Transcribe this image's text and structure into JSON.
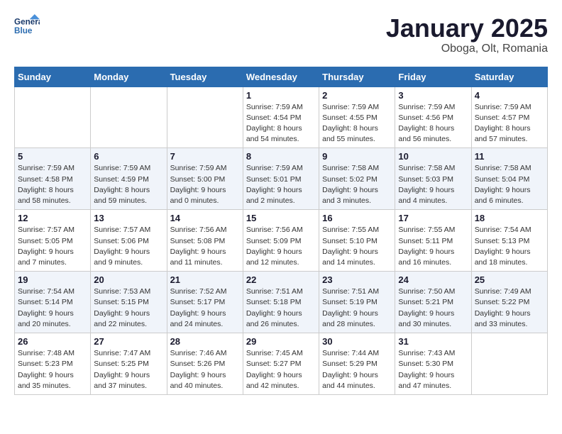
{
  "logo": {
    "line1": "General",
    "line2": "Blue"
  },
  "title": "January 2025",
  "subtitle": "Oboga, Olt, Romania",
  "weekdays": [
    "Sunday",
    "Monday",
    "Tuesday",
    "Wednesday",
    "Thursday",
    "Friday",
    "Saturday"
  ],
  "weeks": [
    [
      {
        "day": "",
        "info": ""
      },
      {
        "day": "",
        "info": ""
      },
      {
        "day": "",
        "info": ""
      },
      {
        "day": "1",
        "info": "Sunrise: 7:59 AM\nSunset: 4:54 PM\nDaylight: 8 hours\nand 54 minutes."
      },
      {
        "day": "2",
        "info": "Sunrise: 7:59 AM\nSunset: 4:55 PM\nDaylight: 8 hours\nand 55 minutes."
      },
      {
        "day": "3",
        "info": "Sunrise: 7:59 AM\nSunset: 4:56 PM\nDaylight: 8 hours\nand 56 minutes."
      },
      {
        "day": "4",
        "info": "Sunrise: 7:59 AM\nSunset: 4:57 PM\nDaylight: 8 hours\nand 57 minutes."
      }
    ],
    [
      {
        "day": "5",
        "info": "Sunrise: 7:59 AM\nSunset: 4:58 PM\nDaylight: 8 hours\nand 58 minutes."
      },
      {
        "day": "6",
        "info": "Sunrise: 7:59 AM\nSunset: 4:59 PM\nDaylight: 8 hours\nand 59 minutes."
      },
      {
        "day": "7",
        "info": "Sunrise: 7:59 AM\nSunset: 5:00 PM\nDaylight: 9 hours\nand 0 minutes."
      },
      {
        "day": "8",
        "info": "Sunrise: 7:59 AM\nSunset: 5:01 PM\nDaylight: 9 hours\nand 2 minutes."
      },
      {
        "day": "9",
        "info": "Sunrise: 7:58 AM\nSunset: 5:02 PM\nDaylight: 9 hours\nand 3 minutes."
      },
      {
        "day": "10",
        "info": "Sunrise: 7:58 AM\nSunset: 5:03 PM\nDaylight: 9 hours\nand 4 minutes."
      },
      {
        "day": "11",
        "info": "Sunrise: 7:58 AM\nSunset: 5:04 PM\nDaylight: 9 hours\nand 6 minutes."
      }
    ],
    [
      {
        "day": "12",
        "info": "Sunrise: 7:57 AM\nSunset: 5:05 PM\nDaylight: 9 hours\nand 7 minutes."
      },
      {
        "day": "13",
        "info": "Sunrise: 7:57 AM\nSunset: 5:06 PM\nDaylight: 9 hours\nand 9 minutes."
      },
      {
        "day": "14",
        "info": "Sunrise: 7:56 AM\nSunset: 5:08 PM\nDaylight: 9 hours\nand 11 minutes."
      },
      {
        "day": "15",
        "info": "Sunrise: 7:56 AM\nSunset: 5:09 PM\nDaylight: 9 hours\nand 12 minutes."
      },
      {
        "day": "16",
        "info": "Sunrise: 7:55 AM\nSunset: 5:10 PM\nDaylight: 9 hours\nand 14 minutes."
      },
      {
        "day": "17",
        "info": "Sunrise: 7:55 AM\nSunset: 5:11 PM\nDaylight: 9 hours\nand 16 minutes."
      },
      {
        "day": "18",
        "info": "Sunrise: 7:54 AM\nSunset: 5:13 PM\nDaylight: 9 hours\nand 18 minutes."
      }
    ],
    [
      {
        "day": "19",
        "info": "Sunrise: 7:54 AM\nSunset: 5:14 PM\nDaylight: 9 hours\nand 20 minutes."
      },
      {
        "day": "20",
        "info": "Sunrise: 7:53 AM\nSunset: 5:15 PM\nDaylight: 9 hours\nand 22 minutes."
      },
      {
        "day": "21",
        "info": "Sunrise: 7:52 AM\nSunset: 5:17 PM\nDaylight: 9 hours\nand 24 minutes."
      },
      {
        "day": "22",
        "info": "Sunrise: 7:51 AM\nSunset: 5:18 PM\nDaylight: 9 hours\nand 26 minutes."
      },
      {
        "day": "23",
        "info": "Sunrise: 7:51 AM\nSunset: 5:19 PM\nDaylight: 9 hours\nand 28 minutes."
      },
      {
        "day": "24",
        "info": "Sunrise: 7:50 AM\nSunset: 5:21 PM\nDaylight: 9 hours\nand 30 minutes."
      },
      {
        "day": "25",
        "info": "Sunrise: 7:49 AM\nSunset: 5:22 PM\nDaylight: 9 hours\nand 33 minutes."
      }
    ],
    [
      {
        "day": "26",
        "info": "Sunrise: 7:48 AM\nSunset: 5:23 PM\nDaylight: 9 hours\nand 35 minutes."
      },
      {
        "day": "27",
        "info": "Sunrise: 7:47 AM\nSunset: 5:25 PM\nDaylight: 9 hours\nand 37 minutes."
      },
      {
        "day": "28",
        "info": "Sunrise: 7:46 AM\nSunset: 5:26 PM\nDaylight: 9 hours\nand 40 minutes."
      },
      {
        "day": "29",
        "info": "Sunrise: 7:45 AM\nSunset: 5:27 PM\nDaylight: 9 hours\nand 42 minutes."
      },
      {
        "day": "30",
        "info": "Sunrise: 7:44 AM\nSunset: 5:29 PM\nDaylight: 9 hours\nand 44 minutes."
      },
      {
        "day": "31",
        "info": "Sunrise: 7:43 AM\nSunset: 5:30 PM\nDaylight: 9 hours\nand 47 minutes."
      },
      {
        "day": "",
        "info": ""
      }
    ]
  ]
}
